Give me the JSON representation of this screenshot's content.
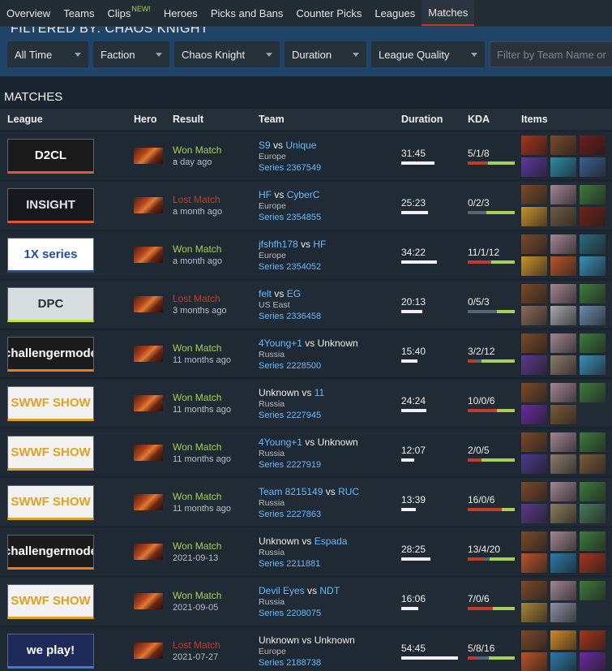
{
  "nav": {
    "items": [
      {
        "label": "Overview"
      },
      {
        "label": "Teams"
      },
      {
        "label": "Clips",
        "badge": "NEW!"
      },
      {
        "label": "Heroes"
      },
      {
        "label": "Picks and Bans"
      },
      {
        "label": "Counter Picks"
      },
      {
        "label": "Leagues"
      },
      {
        "label": "Matches",
        "active": true
      }
    ]
  },
  "filter": {
    "title": "FILTERED BY: CHAOS KNIGHT",
    "time": "All Time",
    "faction": "Faction",
    "hero": "Chaos Knight",
    "duration": "Duration",
    "league_quality": "League Quality",
    "search_placeholder": "Filter by Team Name or"
  },
  "matches": {
    "title": "MATCHES",
    "headers": {
      "league": "League",
      "hero": "Hero",
      "result": "Result",
      "team": "Team",
      "duration": "Duration",
      "kda": "KDA",
      "items": "Items"
    },
    "rows": [
      {
        "league": {
          "text": "D2CL",
          "bg": "#1a1a1a",
          "color": "#ffffff",
          "accent": "#e8592a"
        },
        "result": "Won Match",
        "won": true,
        "when": "a day ago",
        "team1": "S9",
        "team1_link": true,
        "vs": "vs",
        "team2": "Unique",
        "team2_link": true,
        "region": "Europe",
        "series": "Series 2367549",
        "duration": "31:45",
        "duration_frac": 0.55,
        "kda": "5/1/8",
        "k": 5,
        "d": 1,
        "a": 8,
        "items": [
          "#a3361c",
          "#7a4a2a",
          "#6e1c1c",
          "#5b3aa0",
          "#2f8aa8",
          "#3c5f8e"
        ]
      },
      {
        "league": {
          "text": "INSIGHT",
          "bg": "#15191e",
          "color": "#dfe4e8",
          "accent": "#e05a2a"
        },
        "result": "Lost Match",
        "won": false,
        "when": "a month ago",
        "team1": "HF",
        "team1_link": true,
        "vs": "vs",
        "team2": "CyberC",
        "team2_link": true,
        "region": "Europe",
        "series": "Series 2354855",
        "duration": "25:23",
        "duration_frac": 0.44,
        "kda": "0/2/3",
        "k": 0,
        "d": 2,
        "a": 3,
        "items": [
          "#7a4a2a",
          "#a18590",
          "#3f7a3e",
          "#c8922a",
          "#6f5a45",
          "#6e2418"
        ]
      },
      {
        "league": {
          "text": "1X series",
          "bg": "#ffffff",
          "color": "#1c4fa0",
          "accent": "#1c4fa0"
        },
        "result": "Won Match",
        "won": true,
        "when": "a month ago",
        "team1": "jfshfh178",
        "team1_link": true,
        "vs": "vs",
        "team2": "HF",
        "team2_link": true,
        "region": "Europe",
        "series": "Series 2354052",
        "duration": "34:22",
        "duration_frac": 0.6,
        "kda": "11/1/12",
        "k": 11,
        "d": 1,
        "a": 12,
        "items": [
          "#7a4a2a",
          "#a18590",
          "#2c6a7a",
          "#c8922a",
          "#b8542a",
          "#3a8fb5"
        ]
      },
      {
        "league": {
          "text": "DPC",
          "bg": "#d8dde0",
          "color": "#2a2f33",
          "accent": "#c8e03a"
        },
        "result": "Lost Match",
        "won": false,
        "when": "3 months ago",
        "team1": "felt",
        "team1_link": true,
        "vs": "vs",
        "team2": "EG",
        "team2_link": true,
        "region": "US East",
        "series": "Series 2336458",
        "duration": "20:13",
        "duration_frac": 0.35,
        "kda": "0/5/3",
        "k": 0,
        "d": 5,
        "a": 3,
        "items": [
          "#7a4a2a",
          "#a18590",
          "#3f7a3e",
          "#8a6a5a",
          "#a6a8ac",
          "#6a8aa8"
        ]
      },
      {
        "league": {
          "text": "challengermode",
          "bg": "#1b1b1b",
          "color": "#ffffff",
          "accent": "#f07a1a"
        },
        "result": "Won Match",
        "won": true,
        "when": "11 months ago",
        "team1": "4Young+1",
        "team1_link": true,
        "vs": "vs",
        "team2": "Unknown",
        "team2_link": false,
        "region": "Russia",
        "series": "Series 2228500",
        "duration": "15:40",
        "duration_frac": 0.27,
        "kda": "3/2/12",
        "k": 3,
        "d": 2,
        "a": 12,
        "items": [
          "#7a4a2a",
          "#a18590",
          "#3f7a3e",
          "#5a3a8a",
          "#8a7a6a",
          "#3a8fb5"
        ]
      },
      {
        "league": {
          "text": "SWWF SHOW",
          "bg": "#f2f2f2",
          "color": "#e0a020",
          "accent": "#e0a020"
        },
        "result": "Won Match",
        "won": true,
        "when": "11 months ago",
        "team1": "Unknown",
        "team1_link": false,
        "vs": "vs",
        "team2": "11",
        "team2_link": true,
        "region": "Russia",
        "series": "Series 2227945",
        "duration": "24:24",
        "duration_frac": 0.42,
        "kda": "10/0/6",
        "k": 10,
        "d": 0,
        "a": 6,
        "items": [
          "#7a4a2a",
          "#a18590",
          "#3f7a3e",
          "#6a2aa0",
          "#7a5a3a",
          ""
        ]
      },
      {
        "league": {
          "text": "SWWF SHOW",
          "bg": "#f2f2f2",
          "color": "#e0a020",
          "accent": "#e0a020"
        },
        "result": "Won Match",
        "won": true,
        "when": "11 months ago",
        "team1": "4Young+1",
        "team1_link": true,
        "vs": "vs",
        "team2": "Unknown",
        "team2_link": false,
        "region": "Russia",
        "series": "Series 2227919",
        "duration": "12:07",
        "duration_frac": 0.21,
        "kda": "2/0/5",
        "k": 2,
        "d": 0,
        "a": 5,
        "items": [
          "#7a4a2a",
          "#a18590",
          "#3f7a3e",
          "#4a3a8a",
          "#8a7a6a",
          "#7a5a3a"
        ]
      },
      {
        "league": {
          "text": "SWWF SHOW",
          "bg": "#f2f2f2",
          "color": "#e0a020",
          "accent": "#e0a020"
        },
        "result": "Won Match",
        "won": true,
        "when": "11 months ago",
        "team1": "Team 8215149",
        "team1_link": true,
        "vs": "vs",
        "team2": "RUC",
        "team2_link": true,
        "region": "Russia",
        "series": "Series 2227863",
        "duration": "13:39",
        "duration_frac": 0.24,
        "kda": "16/0/6",
        "k": 16,
        "d": 0,
        "a": 6,
        "items": [
          "#7a4a2a",
          "#a18590",
          "#3f7a3e",
          "#5a3a8a",
          "#8a7a5a",
          "#4a7a5a"
        ]
      },
      {
        "league": {
          "text": "challengermode",
          "bg": "#1b1b1b",
          "color": "#ffffff",
          "accent": "#f07a1a"
        },
        "result": "Won Match",
        "won": true,
        "when": "2021-09-13",
        "team1": "Unknown",
        "team1_link": false,
        "vs": "vs",
        "team2": "Espada",
        "team2_link": true,
        "region": "Russia",
        "series": "Series 2211881",
        "duration": "28:25",
        "duration_frac": 0.49,
        "kda": "13/4/20",
        "k": 13,
        "d": 4,
        "a": 20,
        "items": [
          "#7a4a2a",
          "#a18590",
          "#3f7a3e",
          "#b8542a",
          "#2a7aa8",
          "#a3361c"
        ]
      },
      {
        "league": {
          "text": "SWWF SHOW",
          "bg": "#f2f2f2",
          "color": "#e0a020",
          "accent": "#e0a020"
        },
        "result": "Won Match",
        "won": true,
        "when": "2021-09-05",
        "team1": "Devil Eyes",
        "team1_link": true,
        "vs": "vs",
        "team2": "NDT",
        "team2_link": true,
        "region": "Russia",
        "series": "Series 2208075",
        "duration": "16:06",
        "duration_frac": 0.28,
        "kda": "7/0/6",
        "k": 7,
        "d": 0,
        "a": 6,
        "items": [
          "#7a4a2a",
          "#a18590",
          "#3f7a3e",
          "#a8843a",
          "#8a90a0",
          ""
        ]
      },
      {
        "league": {
          "text": "we play!",
          "bg": "#1e2a5a",
          "color": "#ffffff",
          "accent": "#3a7ae0"
        },
        "result": "Lost Match",
        "won": false,
        "when": "2021-07-27",
        "team1": "Unknown",
        "team1_link": false,
        "vs": "vs",
        "team2": "Unknown",
        "team2_link": false,
        "region": "Europe",
        "series": "Series 2188738",
        "duration": "54:45",
        "duration_frac": 0.95,
        "kda": "5/8/16",
        "k": 5,
        "d": 8,
        "a": 16,
        "items": [
          "#7a4a2a",
          "#d08a2a",
          "#a3361c",
          "#b8542a",
          "#2a7aa8",
          "#6a2aa0"
        ]
      }
    ]
  },
  "colors": {
    "won": "#a9cf54",
    "lost": "#c23c2a",
    "link": "#66bbff",
    "kda_kill": "#a9cf54",
    "kda_death": "#c23c2a",
    "kda_assist": "#5a646d"
  }
}
